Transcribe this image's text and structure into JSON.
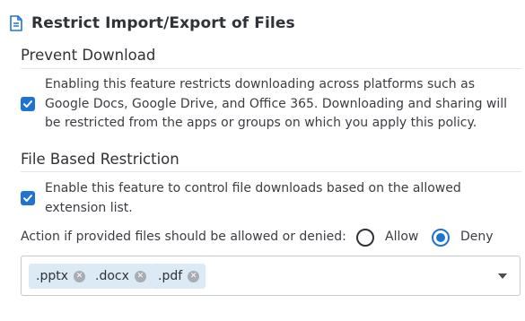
{
  "header": {
    "title": "Restrict Import/Export of Files",
    "icon": "document-icon"
  },
  "prevent_download": {
    "title": "Prevent Download",
    "checked": true,
    "description": "Enabling this feature restricts downloading across platforms such as Google Docs, Google Drive, and Office 365. Downloading and sharing will be restricted from the apps or groups on which you apply this policy."
  },
  "file_based": {
    "title": "File Based Restriction",
    "checked": true,
    "description": "Enable this feature to control file downloads based on the allowed extension list.",
    "action_label": "Action if provided files should be allowed or denied:",
    "options": [
      {
        "label": "Allow",
        "selected": false
      },
      {
        "label": "Deny",
        "selected": true
      }
    ],
    "extensions": [
      ".pptx",
      ".docx",
      ".pdf"
    ]
  },
  "colors": {
    "accent": "#1f73d1",
    "tag_bg": "#dbeaf5",
    "border": "#c5cbd2"
  }
}
